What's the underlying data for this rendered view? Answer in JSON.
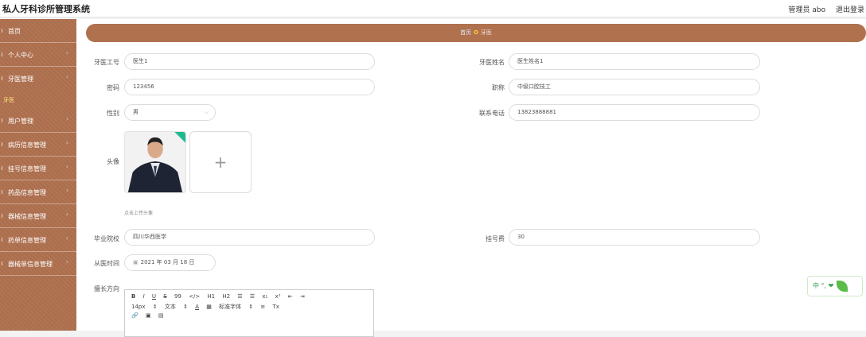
{
  "header": {
    "title": "私人牙科诊所管理系统",
    "user": "管理员 abo",
    "logout": "退出登录"
  },
  "sidebar": {
    "items": [
      {
        "label": "首页"
      },
      {
        "label": "个人中心"
      },
      {
        "label": "牙医管理"
      },
      {
        "label": "用户管理"
      },
      {
        "label": "病历信息管理"
      },
      {
        "label": "挂号信息管理"
      },
      {
        "label": "药品信息管理"
      },
      {
        "label": "器械信息管理"
      },
      {
        "label": "药单信息管理"
      },
      {
        "label": "器械单信息管理"
      }
    ],
    "sub_item": "牙医"
  },
  "breadcrumb": {
    "home": "首页",
    "current": "牙医"
  },
  "form": {
    "dentist_id": {
      "label": "牙医工号",
      "value": "医生1"
    },
    "dentist_name": {
      "label": "牙医姓名",
      "value": "医生姓名1"
    },
    "password": {
      "label": "密码",
      "value": "123456"
    },
    "title": {
      "label": "职称",
      "value": "中级口腔技工"
    },
    "gender": {
      "label": "性别",
      "value": "男"
    },
    "phone": {
      "label": "联系电话",
      "value": "13823888881"
    },
    "avatar": {
      "label": "头像",
      "hint": "点击上传头像"
    },
    "school": {
      "label": "毕业院校",
      "value": "四川华西医学"
    },
    "fee": {
      "label": "挂号费",
      "value": "30"
    },
    "practice_date": {
      "label": "从医时间",
      "value": "2021 年 03 月 18 日"
    },
    "specialty": {
      "label": "擅长方向"
    }
  },
  "editor": {
    "row1": [
      "B",
      "I",
      "U",
      "S",
      "99",
      "</>",
      "H1",
      "H2",
      "☰",
      "☰",
      "x₁",
      "x²",
      "⇤",
      "⇥"
    ],
    "row2": [
      "14px",
      "⇕",
      "文本",
      "⇕",
      "A",
      "▦",
      "标准字体",
      "⇕",
      "≡",
      "Tx"
    ],
    "row3": [
      "🔗",
      "▣",
      "▤"
    ]
  },
  "widget": {
    "text": "中 °, ❤"
  }
}
